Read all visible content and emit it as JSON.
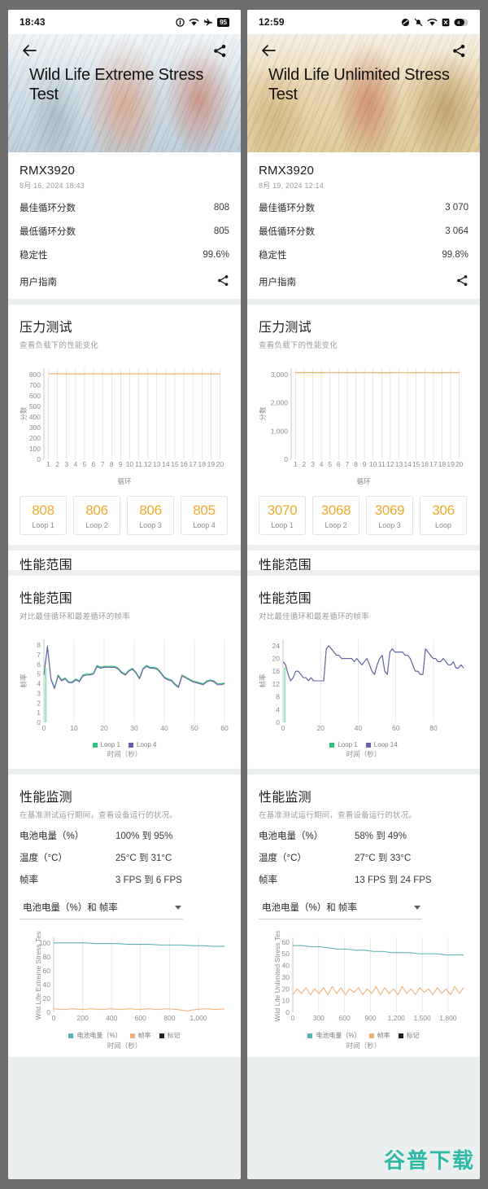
{
  "watermark": "谷普下载",
  "panels": [
    {
      "id": "left",
      "status": {
        "time": "18:43",
        "battery": "95"
      },
      "hero": {
        "title": "Wild Life Extreme Stress Test",
        "back_icon": "arrow-left-icon",
        "share_icon": "share-icon"
      },
      "summary": {
        "device": "RMX3920",
        "date": "8月 16, 2024 18:43",
        "rows": [
          {
            "label": "最佳循环分数",
            "value": "808"
          },
          {
            "label": "最低循环分数",
            "value": "805"
          },
          {
            "label": "稳定性",
            "value": "99.6%"
          }
        ],
        "guide_label": "用户指南"
      },
      "stress": {
        "title": "压力测试",
        "subtitle": "查看负载下的性能变化",
        "chart_ref": 0,
        "loops": [
          {
            "score": "808",
            "label": "Loop 1"
          },
          {
            "score": "806",
            "label": "Loop 2"
          },
          {
            "score": "806",
            "label": "Loop 3"
          },
          {
            "score": "805",
            "label": "Loop 4"
          }
        ]
      },
      "peek_title": "性能范围",
      "range": {
        "title": "性能范围",
        "subtitle": "对比最佳循环和最差循环的帧率",
        "chart_ref": 1
      },
      "monitor": {
        "title": "性能监测",
        "subtitle": "在基准测试运行期间，查看设备运行的状况。",
        "rows": [
          {
            "label": "电池电量（%）",
            "value": "100% 到 95%"
          },
          {
            "label": "温度（°C）",
            "value": "25°C 到 31°C"
          },
          {
            "label": "帧率",
            "value": "3 FPS 到 6 FPS"
          }
        ],
        "dropdown": "电池电量（%）和 帧率",
        "chart_ref": 2
      }
    },
    {
      "id": "right",
      "status": {
        "time": "12:59",
        "battery": ""
      },
      "hero": {
        "title": "Wild Life Unlimited Stress Test",
        "back_icon": "arrow-left-icon",
        "share_icon": "share-icon"
      },
      "summary": {
        "device": "RMX3920",
        "date": "8月 19, 2024 12:14",
        "rows": [
          {
            "label": "最佳循环分数",
            "value": "3 070"
          },
          {
            "label": "最低循环分数",
            "value": "3 064"
          },
          {
            "label": "稳定性",
            "value": "99.8%"
          }
        ],
        "guide_label": "用户指南"
      },
      "stress": {
        "title": "压力测试",
        "subtitle": "查看负载下的性能变化",
        "chart_ref": 3,
        "loops": [
          {
            "score": "3070",
            "label": "Loop 1"
          },
          {
            "score": "3068",
            "label": "Loop 2"
          },
          {
            "score": "3069",
            "label": "Loop 3"
          },
          {
            "score": "306",
            "label": "Loop"
          }
        ]
      },
      "peek_title": "性能范围",
      "range": {
        "title": "性能范围",
        "subtitle": "对比最佳循环和最差循环的帧率",
        "chart_ref": 4
      },
      "monitor": {
        "title": "性能监测",
        "subtitle": "在基准测试运行期间，查看设备运行的状况。",
        "rows": [
          {
            "label": "电池电量（%）",
            "value": "58% 到 49%"
          },
          {
            "label": "温度（°C）",
            "value": "27°C 到 33°C"
          },
          {
            "label": "帧率",
            "value": "13 FPS 到 24 FPS"
          }
        ],
        "dropdown": "电池电量（%）和 帧率",
        "chart_ref": 5
      }
    }
  ],
  "colors": {
    "score_line": "#f0a85c",
    "loop_number": "#f0a92e",
    "loop1_green": "#2ec27e",
    "loop_purple": "#6f5fa8",
    "battery_teal": "#5ab5b0",
    "fps_orange": "#f0b27a",
    "marker_black": "#222222",
    "watermark": "#2eb8a6"
  },
  "chart_data": [
    {
      "type": "line",
      "id": "left-stress-cycles",
      "title": "压力测试",
      "xlabel": "循环",
      "ylabel": "分数",
      "categories": [
        "1",
        "2",
        "3",
        "4",
        "5",
        "6",
        "7",
        "8",
        "9",
        "10",
        "11",
        "12",
        "13",
        "14",
        "15",
        "16",
        "17",
        "18",
        "19",
        "20"
      ],
      "yticks": [
        0,
        100,
        200,
        300,
        400,
        500,
        600,
        700,
        800
      ],
      "ylim": [
        0,
        860
      ],
      "grid": "vertical",
      "series": [
        {
          "name": "分数",
          "color": "#f0a85c",
          "values": [
            808,
            806,
            806,
            805,
            806,
            806,
            806,
            805,
            806,
            806,
            806,
            806,
            806,
            805,
            806,
            806,
            806,
            806,
            806,
            805
          ]
        }
      ]
    },
    {
      "type": "line",
      "id": "left-range-fps",
      "title": "性能范围",
      "xlabel": "时间（秒）",
      "ylabel": "帧率",
      "xticks": [
        0,
        10,
        20,
        30,
        40,
        50,
        60
      ],
      "yticks": [
        0,
        1,
        2,
        3,
        4,
        5,
        6,
        7,
        8
      ],
      "xlim": [
        0,
        60
      ],
      "ylim": [
        0,
        8.6
      ],
      "grid": "vertical",
      "legend": [
        "Loop 1",
        "Loop 4"
      ],
      "legend_position": "bottom",
      "series": [
        {
          "name": "Loop 1",
          "color": "#2ec27e",
          "values": [
            5.0,
            7.9,
            4.5,
            3.6,
            4.9,
            4.4,
            4.6,
            4.2,
            4.2,
            4.5,
            4.3,
            4.9,
            5.0,
            5.0,
            5.1,
            5.9,
            5.7,
            5.8,
            5.8,
            5.8,
            5.8,
            5.6,
            5.2,
            5.0,
            5.4,
            5.6,
            5.2,
            4.6,
            5.6,
            5.9,
            5.7,
            5.7,
            5.6,
            5.2,
            4.7,
            4.5,
            4.4,
            4.0,
            3.7,
            4.9,
            4.7,
            4.5,
            4.3,
            4.2,
            4.1,
            4.0,
            4.3,
            4.4,
            4.3,
            4.0,
            4.0,
            4.1
          ]
        },
        {
          "name": "Loop 4",
          "color": "#6f5fa8",
          "values": [
            4.9,
            7.8,
            4.4,
            3.5,
            4.8,
            4.3,
            4.5,
            4.1,
            4.1,
            4.4,
            4.2,
            4.8,
            4.9,
            4.9,
            5.0,
            5.8,
            5.6,
            5.7,
            5.7,
            5.7,
            5.7,
            5.5,
            5.1,
            4.9,
            5.3,
            5.5,
            5.1,
            4.5,
            5.5,
            5.8,
            5.6,
            5.6,
            5.5,
            5.1,
            4.6,
            4.4,
            4.3,
            3.9,
            3.6,
            4.8,
            4.6,
            4.4,
            4.2,
            4.1,
            4.0,
            3.9,
            4.2,
            4.3,
            4.2,
            3.9,
            3.9,
            4.0
          ]
        }
      ]
    },
    {
      "type": "line",
      "id": "left-monitor",
      "title": "电池电量（%）和 帧率",
      "xlabel": "时间（秒）",
      "ylabel": "Wild Life Extreme Stress Test",
      "xticks": [
        0,
        200,
        400,
        600,
        800,
        1000
      ],
      "xtick_labels": [
        "0",
        "200",
        "400",
        "600",
        "800",
        "1,000"
      ],
      "yticks": [
        0,
        20,
        40,
        60,
        80,
        100
      ],
      "xlim": [
        0,
        1180
      ],
      "ylim": [
        0,
        108
      ],
      "grid": "vertical",
      "legend": [
        "电池电量（%）",
        "帧率",
        "标记"
      ],
      "legend_position": "bottom",
      "series": [
        {
          "name": "电池电量（%）",
          "color": "#5ab5b0",
          "values": [
            100,
            100,
            100,
            100,
            99,
            99,
            99,
            98,
            98,
            98,
            97,
            97,
            97,
            96,
            96,
            95,
            95
          ]
        },
        {
          "name": "帧率",
          "color": "#f0b27a",
          "values": [
            5,
            4,
            5,
            4,
            5,
            4,
            5,
            4,
            5,
            4,
            5,
            4,
            5,
            4,
            2,
            4,
            5,
            4,
            5
          ]
        },
        {
          "name": "标记",
          "color": "#222222",
          "values": []
        }
      ]
    },
    {
      "type": "line",
      "id": "right-stress-cycles",
      "title": "压力测试",
      "xlabel": "循环",
      "ylabel": "分数",
      "categories": [
        "1",
        "2",
        "3",
        "4",
        "5",
        "6",
        "7",
        "8",
        "9",
        "10",
        "11",
        "12",
        "13",
        "14",
        "15",
        "16",
        "17",
        "18",
        "19",
        "20"
      ],
      "yticks": [
        0,
        1000,
        2000,
        3000
      ],
      "ytick_labels": [
        "0",
        "1,000",
        "2,000",
        "3,000"
      ],
      "ylim": [
        0,
        3230
      ],
      "grid": "vertical",
      "series": [
        {
          "name": "分数",
          "color": "#f0a85c",
          "values": [
            3070,
            3068,
            3069,
            3067,
            3068,
            3068,
            3067,
            3066,
            3068,
            3067,
            3066,
            3067,
            3068,
            3064,
            3067,
            3068,
            3066,
            3067,
            3068,
            3065
          ]
        }
      ]
    },
    {
      "type": "line",
      "id": "right-range-fps",
      "title": "性能范围",
      "xlabel": "时间（秒）",
      "ylabel": "帧率",
      "xticks": [
        0,
        20,
        40,
        60,
        80
      ],
      "yticks": [
        0,
        4,
        8,
        12,
        16,
        20,
        24
      ],
      "xlim": [
        0,
        96
      ],
      "ylim": [
        0,
        26
      ],
      "grid": "vertical",
      "legend": [
        "Loop 1",
        "Loop 14"
      ],
      "legend_position": "bottom",
      "series": [
        {
          "name": "Loop 1",
          "color": "#2ec27e",
          "values": [
            19,
            18,
            15,
            13,
            14,
            16,
            16,
            15,
            14,
            14,
            13,
            14,
            13,
            13,
            13,
            13,
            13,
            23,
            24,
            23,
            22,
            21,
            21,
            20,
            20,
            20,
            20,
            20,
            19,
            20,
            19,
            18,
            19,
            20,
            18,
            16,
            15,
            18,
            20,
            21,
            16,
            15,
            22,
            23,
            22,
            22,
            22,
            22,
            21,
            21,
            20,
            18,
            16,
            16,
            15,
            15,
            23,
            22,
            21,
            20,
            20,
            19,
            19,
            20,
            19,
            18,
            18,
            19,
            17,
            17,
            18,
            17
          ]
        },
        {
          "name": "Loop 14",
          "color": "#6f5fa8",
          "values": [
            19,
            18,
            15,
            13,
            14,
            16,
            16,
            15,
            14,
            14,
            13,
            14,
            13,
            13,
            13,
            13,
            13,
            23,
            24,
            23,
            22,
            21,
            21,
            20,
            20,
            20,
            20,
            20,
            19,
            20,
            19,
            18,
            19,
            20,
            18,
            16,
            15,
            18,
            20,
            21,
            16,
            15,
            22,
            23,
            22,
            22,
            22,
            22,
            21,
            21,
            20,
            18,
            16,
            16,
            15,
            15,
            23,
            22,
            21,
            20,
            20,
            19,
            19,
            20,
            19,
            18,
            18,
            19,
            17,
            17,
            18,
            17
          ]
        }
      ]
    },
    {
      "type": "line",
      "id": "right-monitor",
      "title": "电池电量（%）和 帧率",
      "xlabel": "时间（秒）",
      "ylabel": "Wild Life Unlimited Stress Test",
      "xticks": [
        0,
        300,
        600,
        900,
        1200,
        1500,
        1800
      ],
      "xtick_labels": [
        "0",
        "300",
        "600",
        "900",
        "1,200",
        "1,500",
        "1,800"
      ],
      "yticks": [
        0,
        10,
        20,
        30,
        40,
        50,
        60
      ],
      "xlim": [
        0,
        1980
      ],
      "ylim": [
        0,
        64
      ],
      "grid": "vertical",
      "legend": [
        "电池电量（%）",
        "帧率",
        "标记"
      ],
      "legend_position": "bottom",
      "series": [
        {
          "name": "电池电量（%）",
          "color": "#5ab5b0",
          "values": [
            57,
            57,
            56,
            56,
            55,
            54,
            54,
            53,
            53,
            52,
            52,
            51,
            51,
            51,
            50,
            50,
            50,
            49,
            49,
            49
          ]
        },
        {
          "name": "帧率",
          "color": "#f0b27a",
          "values": [
            15,
            20,
            16,
            21,
            15,
            20,
            16,
            21,
            15,
            22,
            16,
            21,
            15,
            20,
            17,
            21,
            15,
            20,
            16,
            22,
            15,
            21,
            16,
            20,
            15,
            22,
            16,
            20,
            15,
            21,
            17,
            20,
            15,
            21,
            16,
            20,
            15,
            22,
            16,
            21
          ]
        },
        {
          "name": "标记",
          "color": "#222222",
          "values": []
        }
      ]
    }
  ]
}
